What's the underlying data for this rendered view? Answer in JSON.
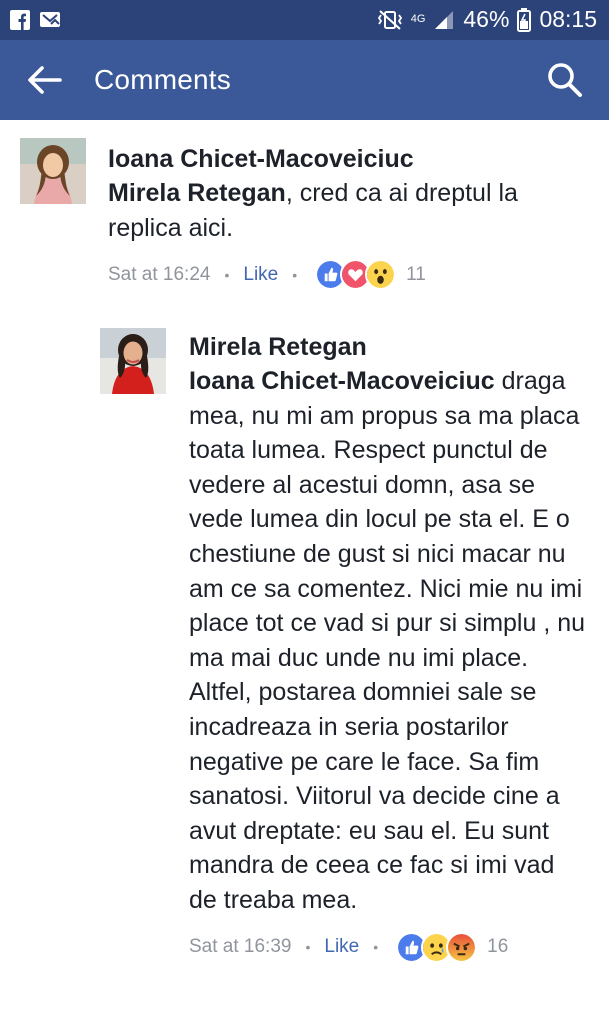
{
  "status_bar": {
    "network": "4G",
    "battery": "46%",
    "time": "08:15",
    "icons": [
      "facebook-icon",
      "messenger-icon",
      "vibrate-icon",
      "signal-icon",
      "battery-icon"
    ]
  },
  "app_bar": {
    "title": "Comments",
    "back_icon": "arrow-left-icon",
    "search_icon": "search-icon",
    "background": "#3b5998"
  },
  "comments": [
    {
      "author": "Ioana Chicet-Macoveiciuc",
      "mention": "Mirela Retegan",
      "text": ", cred ca ai dreptul la replica aici.",
      "time": "Sat at 16:24",
      "like_label": "Like",
      "reactions": [
        "like",
        "love",
        "wow"
      ],
      "reaction_count": "11"
    },
    {
      "author": "Mirela Retegan",
      "mention": "Ioana Chicet-Macoveiciuc",
      "text": " draga mea, nu mi am propus sa ma placa toata lumea. Respect punctul de vedere al acestui domn, asa se vede lumea din locul pe sta el. E o chestiune de gust si nici macar nu am ce sa comentez. Nici mie nu imi place tot ce vad si pur si simplu , nu ma mai duc unde nu imi place. Altfel, postarea domniei sale se incadreaza in seria postarilor negative pe care le face. Sa fim sanatosi. Viitorul va decide cine a avut dreptate: eu sau el. Eu sunt mandra de ceea ce fac si imi vad de treaba mea.",
      "time": "Sat at 16:39",
      "like_label": "Like",
      "reactions": [
        "like",
        "sad",
        "angry"
      ],
      "reaction_count": "16"
    }
  ],
  "colors": {
    "status_bar": "#2b4378",
    "link_blue": "#4267b2",
    "meta_gray": "#90949c",
    "text": "#1d2129"
  }
}
